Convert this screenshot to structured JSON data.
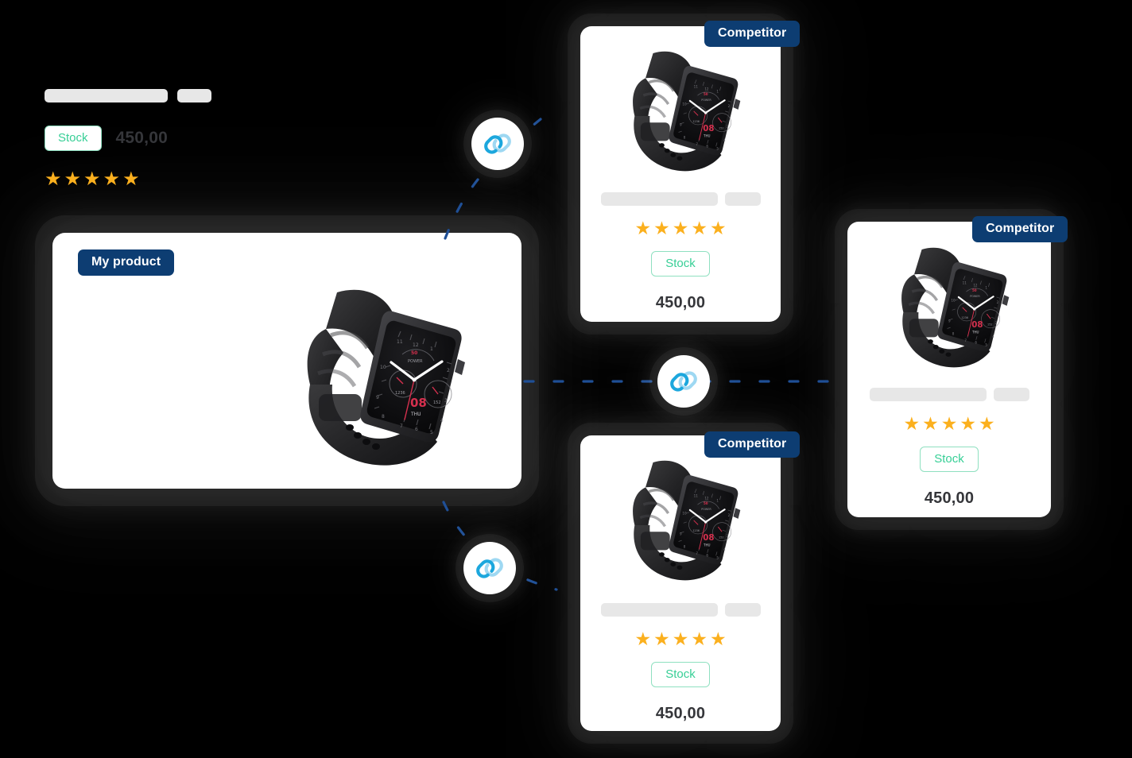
{
  "meta": {
    "background_color": "#000000",
    "accent_badge_color": "#0d3d72",
    "star_color": "#fbb01e",
    "stock_color": "#37cf96",
    "stock_border_color": "#8fe0c0",
    "price_color": "#35363a",
    "placeholder_color": "#e7e7e7",
    "connector_color": "#1f4f96",
    "link_icon_dark": "#1ca7dd",
    "link_icon_light": "#9ed8f2"
  },
  "main_product": {
    "badge_label": "My product",
    "stock_label": "Stock",
    "price": "450,00",
    "rating_stars": 5,
    "star_glyph": "★",
    "placeholder_bars": 2,
    "product_image_name": "smartwatch-black"
  },
  "competitors": [
    {
      "id": "competitor-top",
      "badge_label": "Competitor",
      "stock_label": "Stock",
      "price": "450,00",
      "rating_stars": 5,
      "placeholder_bars": 2,
      "product_image_name": "smartwatch-black"
    },
    {
      "id": "competitor-bottom",
      "badge_label": "Competitor",
      "stock_label": "Stock",
      "price": "450,00",
      "rating_stars": 5,
      "placeholder_bars": 2,
      "product_image_name": "smartwatch-black"
    },
    {
      "id": "competitor-right",
      "badge_label": "Competitor",
      "stock_label": "Stock",
      "price": "450,00",
      "rating_stars": 5,
      "placeholder_bars": 2,
      "product_image_name": "smartwatch-black"
    }
  ],
  "link_nodes": [
    {
      "id": "link-node-top",
      "icon": "link-chain-icon"
    },
    {
      "id": "link-node-middle",
      "icon": "link-chain-icon"
    },
    {
      "id": "link-node-bottom",
      "icon": "link-chain-icon"
    }
  ],
  "watch_face": {
    "day_number": "08",
    "weekday": "THU",
    "power_label": "POWER",
    "left_subdial": "1236",
    "right_subdial": "152"
  }
}
